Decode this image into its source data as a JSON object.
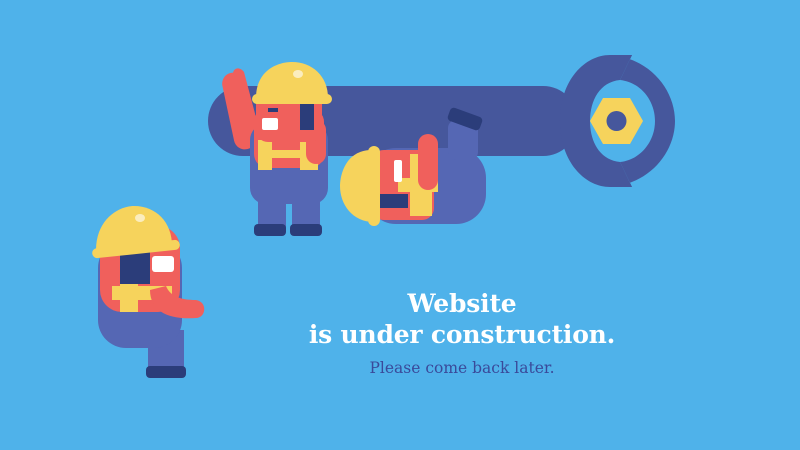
{
  "message": {
    "line1": "Website",
    "line2": "is under construction.",
    "subtext": "Please come back later."
  },
  "colors": {
    "background": "#4fb2ea",
    "wrench": "#46579c",
    "helmet": "#f6d35c",
    "skin": "#f0605c",
    "overalls": "#5567b4",
    "vest": "#f6d35c",
    "hair": "#2b3d7a",
    "headline": "#ffffff",
    "subtext": "#3a4a9a"
  }
}
